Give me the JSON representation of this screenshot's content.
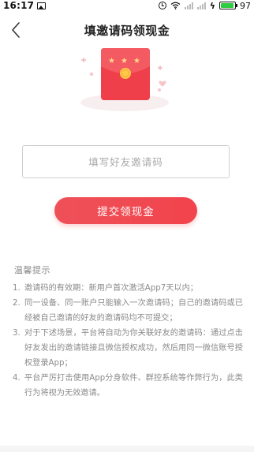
{
  "status_bar": {
    "time": "16:17",
    "battery_level": "97",
    "battery_color": "#2ecc40"
  },
  "header": {
    "title": "填邀请码领现金"
  },
  "form": {
    "placeholder": "填写好友邀请码",
    "value": "",
    "submit_label": "提交领现金",
    "accent_color": "#ef4a53"
  },
  "tips": {
    "title": "温馨提示",
    "items": [
      {
        "num": "1.",
        "text": "邀请码的有效期：新用户首次激活App7天以内；"
      },
      {
        "num": "2.",
        "text": "同一设备、同一账户只能输入一次邀请码；自己的邀请码或已经被自己邀请的好友的邀请码均不可提交；"
      },
      {
        "num": "3.",
        "text": "对于下述场景，平台将自动为你关联好友的邀请码：通过点击好友发出的邀请链接且微信授权成功，然后用同一微信账号授权登录App；"
      },
      {
        "num": "4.",
        "text": "平台严厉打击使用App分身软件、群控系统等作弊行为，此类行为将视为无效邀请。"
      }
    ]
  }
}
